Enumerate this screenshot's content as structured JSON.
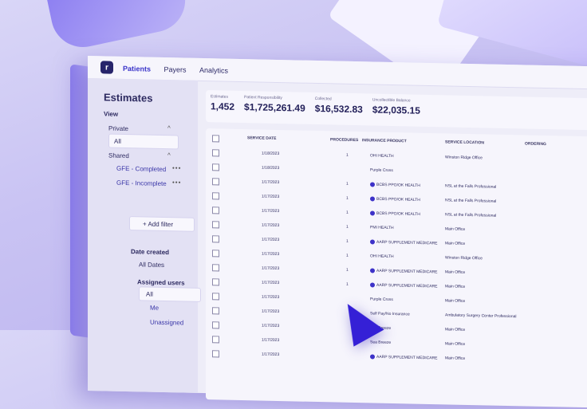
{
  "topbar": {
    "logo": "r",
    "nav": [
      "Patients",
      "Payers",
      "Analytics"
    ]
  },
  "sidebar": {
    "title": "Estimates",
    "view_label": "View",
    "private_label": "Private",
    "private_all": "All",
    "shared_label": "Shared",
    "shared_items": [
      "GFE - Completed",
      "GFE - Incomplete"
    ],
    "add_filter": "+ Add filter",
    "date_created_label": "Date created",
    "date_created_value": "All Dates",
    "assigned_label": "Assigned users",
    "assigned_items": [
      "All",
      "Me",
      "Unassigned"
    ]
  },
  "stats": [
    {
      "label": "Estimates",
      "value": "1,452"
    },
    {
      "label": "Patient Responsibility",
      "value": "$1,725,261.49"
    },
    {
      "label": "Collected",
      "value": "$16,532.83"
    },
    {
      "label": "Uncollectible Balance",
      "value": "$22,035.15"
    }
  ],
  "table": {
    "headers": [
      "SERVICE DATE",
      "PROCEDURES",
      "INSURANCE PRODUCT",
      "SERVICE LOCATION",
      "ORDERING"
    ],
    "rows": [
      {
        "date": "1/18/2023",
        "proc": "1",
        "ins": "OHI HEALTH",
        "loc": "Winston Ridge Office"
      },
      {
        "date": "1/18/2023",
        "proc": "",
        "ins": "Purple Cross",
        "loc": ""
      },
      {
        "date": "1/17/2023",
        "proc": "1",
        "ins": "BCBS PPO/OK HEALTH",
        "loc": "NSL at the Falls Professional"
      },
      {
        "date": "1/17/2023",
        "proc": "1",
        "ins": "BCBS PPO/OK HEALTH",
        "loc": "NSL at the Falls Professional"
      },
      {
        "date": "1/17/2023",
        "proc": "1",
        "ins": "BCBS PPO/OK HEALTH",
        "loc": "NSL at the Falls Professional"
      },
      {
        "date": "1/17/2023",
        "proc": "1",
        "ins": "PMI HEALTH",
        "loc": "Main Office"
      },
      {
        "date": "1/17/2023",
        "proc": "1",
        "ins": "AARP SUPPLEMENT MEDICARE",
        "loc": "Main Office"
      },
      {
        "date": "1/17/2023",
        "proc": "1",
        "ins": "OHI HEALTH",
        "loc": "Winston Ridge Office"
      },
      {
        "date": "1/17/2023",
        "proc": "1",
        "ins": "AARP SUPPLEMENT MEDICARE",
        "loc": "Main Office"
      },
      {
        "date": "1/17/2023",
        "proc": "1",
        "ins": "AARP SUPPLEMENT MEDICARE",
        "loc": "Main Office"
      },
      {
        "date": "1/17/2023",
        "proc": "",
        "ins": "Purple Cross",
        "loc": "Main Office"
      },
      {
        "date": "1/17/2023",
        "proc": "",
        "ins": "Self Pay/No Insurance",
        "loc": "Ambulatory Surgery Center Professional"
      },
      {
        "date": "1/17/2023",
        "proc": "",
        "ins": "Sea Breeze",
        "loc": "Main Office"
      },
      {
        "date": "1/17/2023",
        "proc": "",
        "ins": "Sea Breeze",
        "loc": "Main Office"
      },
      {
        "date": "1/17/2023",
        "proc": "",
        "ins": "AARP SUPPLEMENT MEDICARE",
        "loc": "Main Office"
      }
    ]
  }
}
